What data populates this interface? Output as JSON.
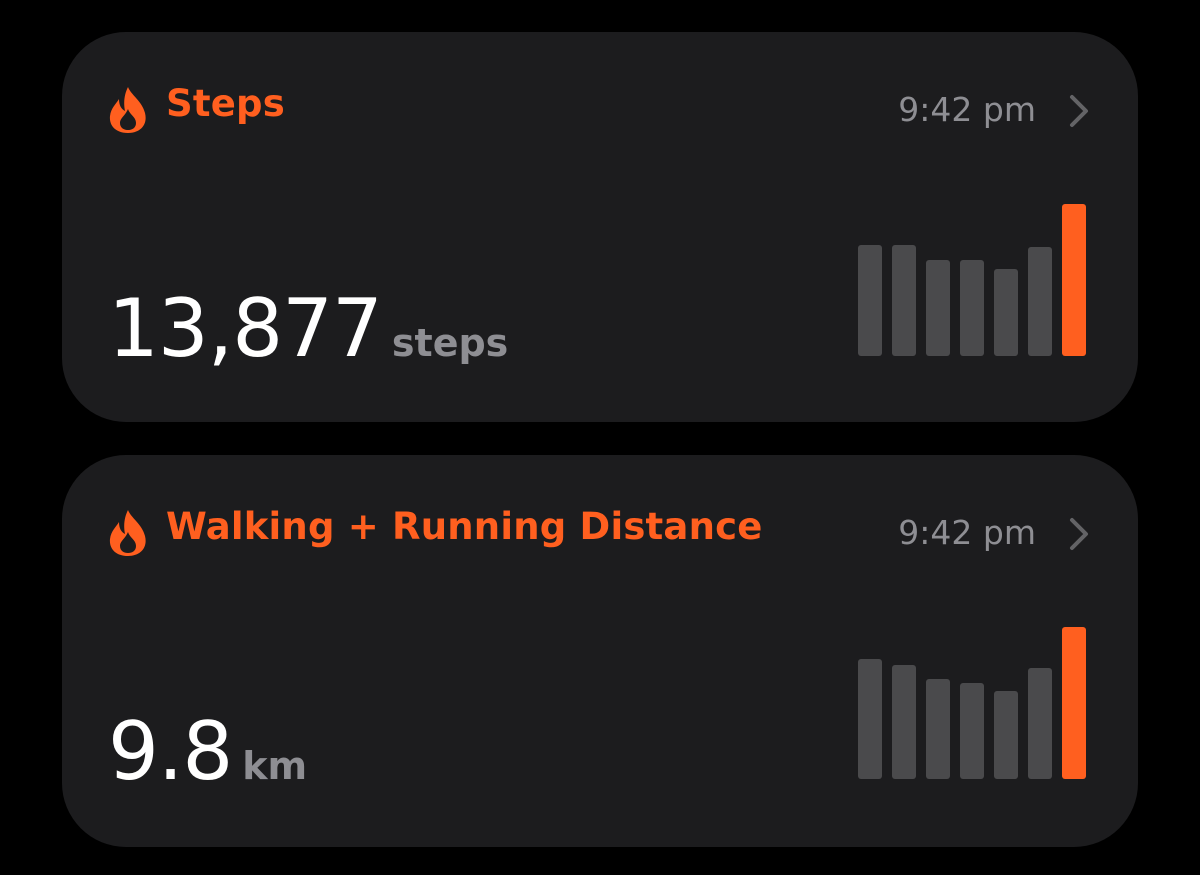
{
  "accent": "#ff5f1f",
  "bar_inactive": "#4a4a4c",
  "cards": [
    {
      "title": "Steps",
      "time": "9:42 pm",
      "value": "13,877",
      "unit": "steps",
      "icon": "flame-icon",
      "trend": [
        0.73,
        0.73,
        0.63,
        0.63,
        0.57,
        0.72,
        1.0
      ]
    },
    {
      "title": "Walking + Running Distance",
      "time": "9:42 pm",
      "value": "9.8",
      "unit": "km",
      "icon": "flame-icon",
      "trend": [
        0.79,
        0.75,
        0.66,
        0.63,
        0.58,
        0.73,
        1.0
      ]
    }
  ]
}
